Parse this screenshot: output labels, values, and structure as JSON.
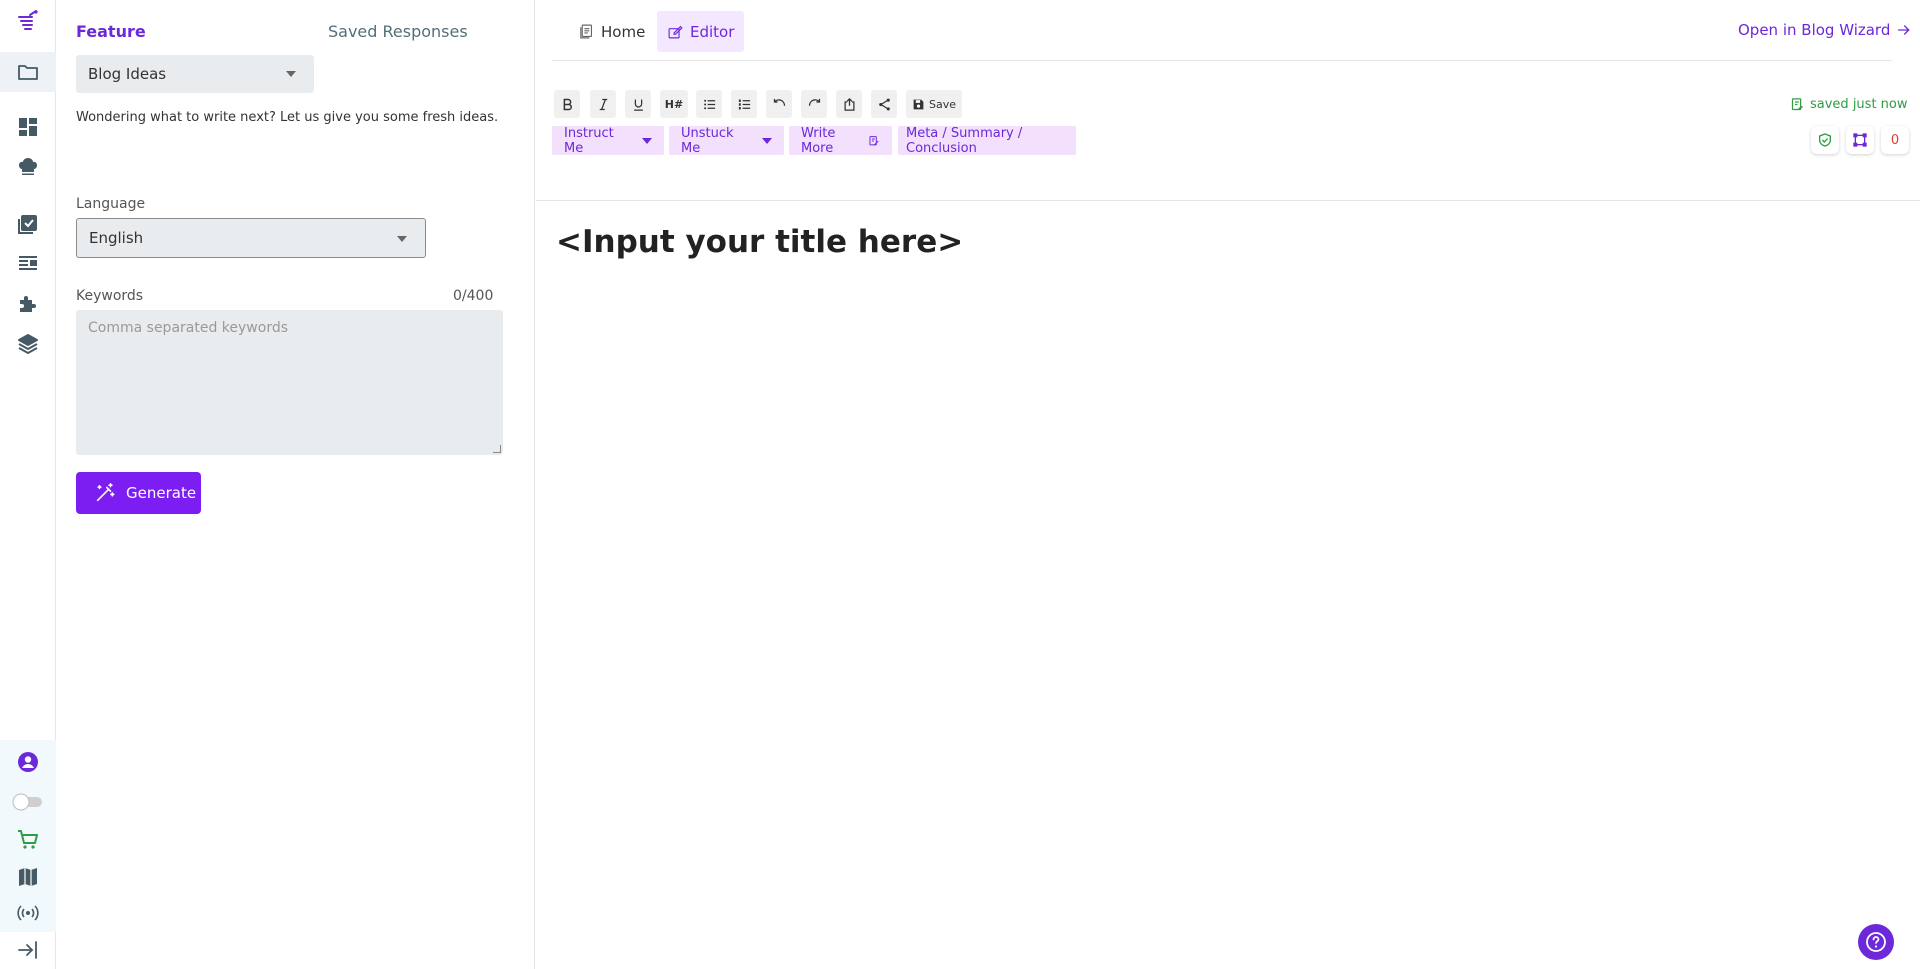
{
  "panel": {
    "tab_feature": "Feature",
    "tab_saved": "Saved Responses",
    "feature_select": "Blog Ideas",
    "description": "Wondering what to write next? Let us give you some fresh ideas.",
    "language_label": "Language",
    "language_select": "English",
    "keywords_label": "Keywords",
    "keywords_count": "0/400",
    "keywords_placeholder": "Comma separated keywords",
    "generate_label": "Generate"
  },
  "editor": {
    "tab_home": "Home",
    "tab_editor": "Editor",
    "open_blog_wizard": "Open in Blog Wizard",
    "save_label": "Save",
    "saved_status": "saved just now",
    "instruct_me": "Instruct Me",
    "unstuck_me": "Unstuck Me",
    "write_more": "Write More",
    "meta_summary": "Meta / Summary / Conclusion",
    "issue_count": "0",
    "title_placeholder": "<Input your title here>",
    "heading_label": "H#"
  },
  "colors": {
    "accent": "#6d28d9",
    "generate": "#7c1df2",
    "saved_green": "#2e9d43",
    "rail_green": "#2e9d43"
  }
}
